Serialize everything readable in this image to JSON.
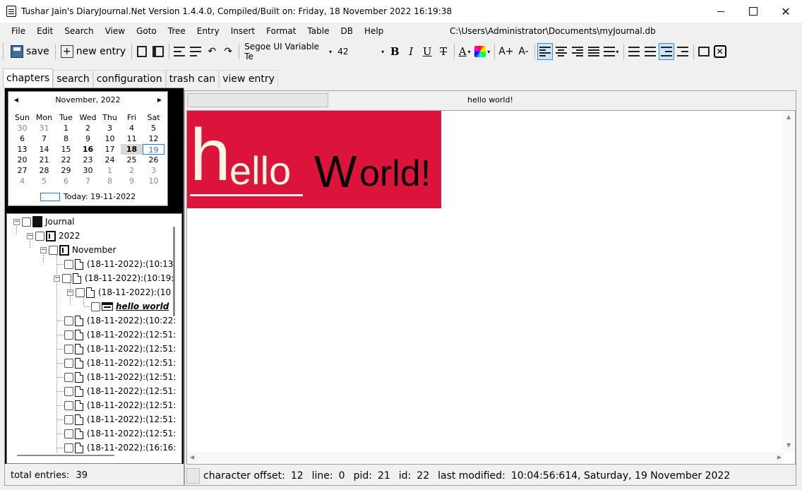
{
  "window": {
    "title": "Tushar Jain's DiaryJournal.Net Version 1.4.4.0, Compiled/Built on: Friday, 18 November 2022 16:19:38",
    "close_glyph": "✕"
  },
  "menu": {
    "items": [
      "File",
      "Edit",
      "Search",
      "View",
      "Goto",
      "Tree",
      "Entry",
      "Insert",
      "Format",
      "Table",
      "DB",
      "Help"
    ],
    "file_path": "C:\\Users\\Administrator\\Documents\\myJournal.db"
  },
  "toolbar": {
    "save_label": "save",
    "new_entry_label": "new entry",
    "font_family": "Segoe UI Variable Te",
    "font_size": "42",
    "bold": "B",
    "italic": "I",
    "underline": "U",
    "strike": "T",
    "font_color": "A",
    "grow_font": "A+",
    "shrink_font": "A-",
    "close_glyph": "✕",
    "undo_glyph": "↶",
    "redo_glyph": "↷",
    "dropdown_glyph": "▾"
  },
  "tabs": [
    "chapters",
    "search",
    "configuration",
    "trash can",
    "view entry"
  ],
  "calendar": {
    "month_label": "November, 2022",
    "prev_glyph": "◀",
    "next_glyph": "▶",
    "weekdays": [
      "Sun",
      "Mon",
      "Tue",
      "Wed",
      "Thu",
      "Fri",
      "Sat"
    ],
    "weeks": [
      [
        "30",
        "31",
        "1",
        "2",
        "3",
        "4",
        "5"
      ],
      [
        "6",
        "7",
        "8",
        "9",
        "10",
        "11",
        "12"
      ],
      [
        "13",
        "14",
        "15",
        "16",
        "17",
        "18",
        "19"
      ],
      [
        "20",
        "21",
        "22",
        "23",
        "24",
        "25",
        "26"
      ],
      [
        "27",
        "28",
        "29",
        "30",
        "1",
        "2",
        "3"
      ],
      [
        "4",
        "5",
        "6",
        "7",
        "8",
        "9",
        "10"
      ]
    ],
    "today_label": "Today: 19-11-2022"
  },
  "tree": {
    "root": "Journal",
    "year": "2022",
    "month": "November",
    "entries": [
      "(18-11-2022):(10:13:",
      "(18-11-2022):(10:19:",
      "(18-11-2022):(10",
      "hello world",
      "(18-11-2022):(10:22:",
      "(18-11-2022):(12:51:",
      "(18-11-2022):(12:51:",
      "(18-11-2022):(12:51:",
      "(18-11-2022):(12:51:",
      "(18-11-2022):(12:51:",
      "(18-11-2022):(12:51:",
      "(18-11-2022):(12:51:",
      "(18-11-2022):(12:51:",
      "(18-11-2022):(16:16:"
    ],
    "expand_glyph": "−"
  },
  "left_status": {
    "label": "total entries:",
    "value": "39"
  },
  "entry": {
    "title": "hello world!",
    "content": {
      "h": "h",
      "ello": "ello",
      "W": "W",
      "orld": "orld!"
    }
  },
  "status": {
    "char_offset_label": "character offset:",
    "char_offset": "12",
    "line_label": "line:",
    "line": "0",
    "pid_label": "pid:",
    "pid": "21",
    "id_label": "id:",
    "id": "22",
    "modified_label": "last modified:",
    "modified": "10:04:56:614, Saturday, 19 November 2022"
  },
  "colors": {
    "content_bg": "#dc143c",
    "content_text_light": "#fff5e1",
    "today_accent": "#2a7ad6"
  }
}
